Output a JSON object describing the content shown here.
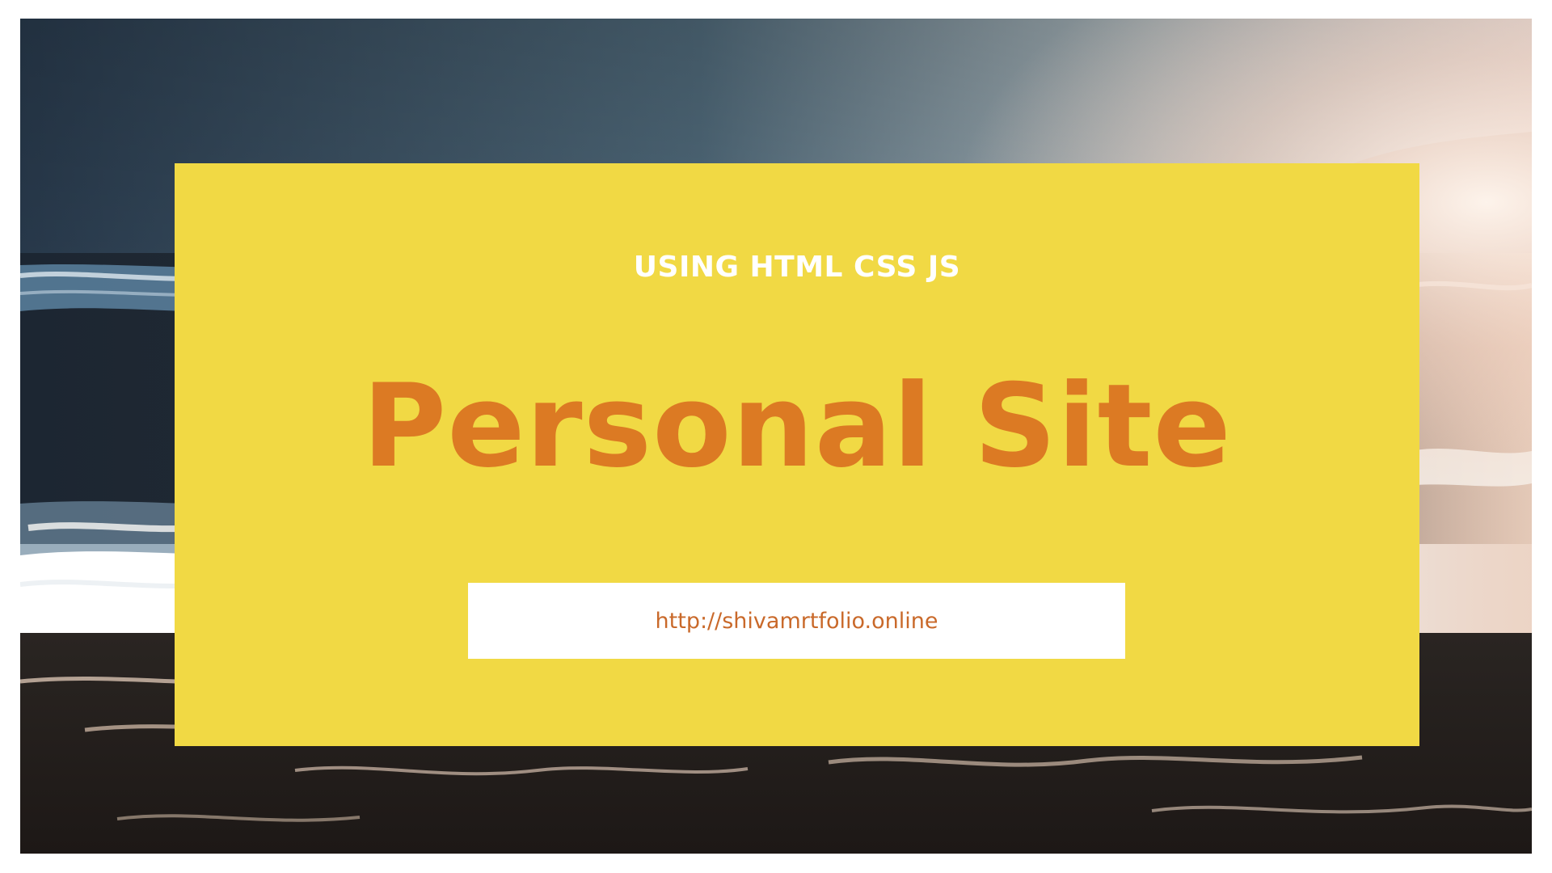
{
  "colors": {
    "card_background": "#f1d944",
    "title": "#dc7a23",
    "url_text": "#c9692a",
    "url_box": "#ffffff",
    "subtitle": "#ffffff"
  },
  "banner": {
    "subtitle": "USING HTML CSS JS",
    "title": "Personal Site",
    "url": "http://shivamrtfolio.online"
  }
}
